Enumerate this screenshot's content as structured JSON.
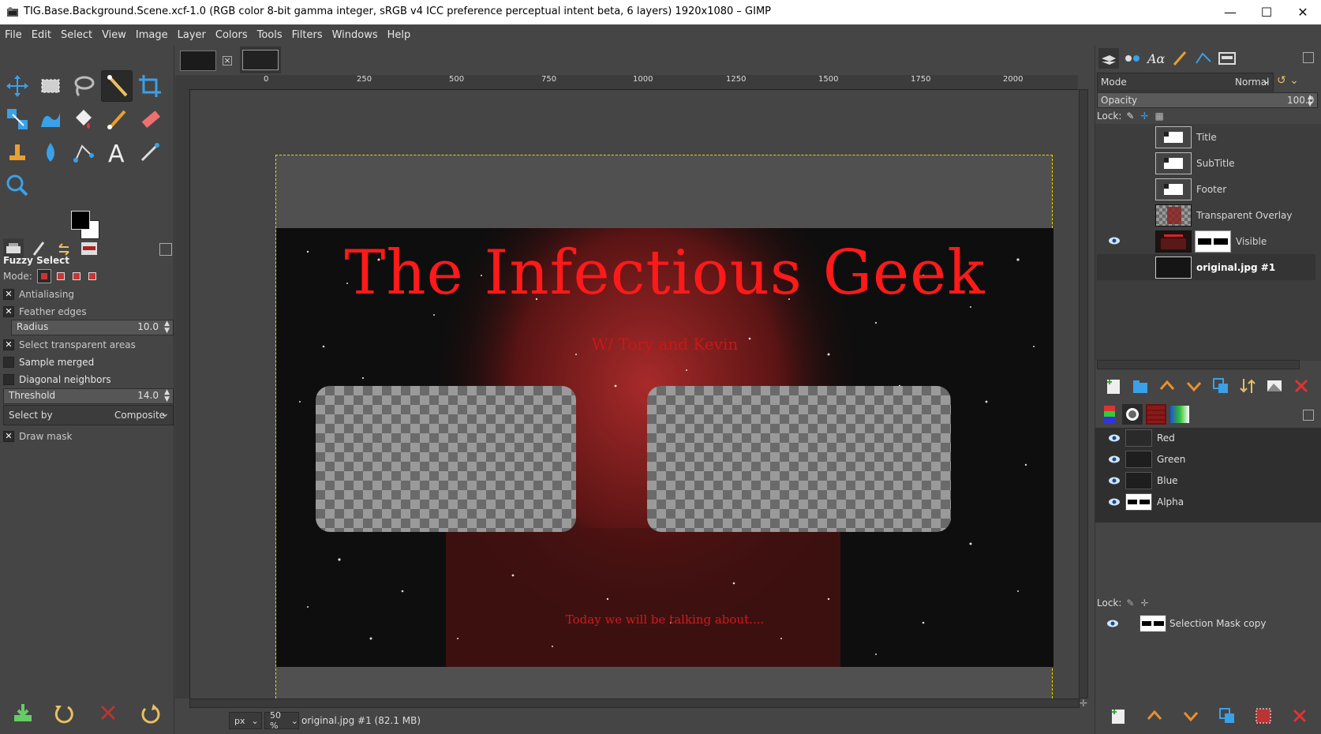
{
  "window": {
    "title": "TIG.Base.Background.Scene.xcf-1.0 (RGB color 8-bit gamma integer, sRGB v4 ICC preference perceptual intent beta, 6 layers) 1920x1080 – GIMP",
    "minimize": "—",
    "maximize": "☐",
    "close": "✕"
  },
  "menu": [
    "File",
    "Edit",
    "Select",
    "View",
    "Image",
    "Layer",
    "Colors",
    "Tools",
    "Filters",
    "Windows",
    "Help"
  ],
  "tool_options": {
    "title": "Fuzzy Select",
    "mode_label": "Mode:",
    "antialiasing": "Antialiasing",
    "feather_edges": "Feather edges",
    "radius_label": "Radius",
    "radius_value": "10.0",
    "select_transparent": "Select transparent areas",
    "sample_merged": "Sample merged",
    "diagonal_neighbors": "Diagonal neighbors",
    "threshold_label": "Threshold",
    "threshold_value": "14.0",
    "select_by_label": "Select by",
    "select_by_value": "Composite",
    "draw_mask": "Draw mask"
  },
  "ruler_ticks": [
    "0",
    "250",
    "500",
    "750",
    "1000",
    "1250",
    "1500",
    "1750",
    "2000"
  ],
  "image": {
    "headline": "The Infectious Geek",
    "subhead": "W/ Tory and Kevin",
    "footer": "Today we will be talking about...."
  },
  "status": {
    "unit": "px",
    "zoom": "50 %",
    "info": "original.jpg #1 (82.1 MB)"
  },
  "layers_panel": {
    "mode_label": "Mode",
    "mode_value": "Normal",
    "opacity_label": "Opacity",
    "opacity_value": "100.0",
    "lock_label": "Lock:",
    "layers": [
      {
        "name": "Title"
      },
      {
        "name": "SubTitle"
      },
      {
        "name": "Footer"
      },
      {
        "name": "Transparent Overlay"
      },
      {
        "name": "Visible"
      },
      {
        "name": "original.jpg #1"
      }
    ]
  },
  "channels_panel": {
    "channels": [
      "Red",
      "Green",
      "Blue",
      "Alpha"
    ],
    "lock_label": "Lock:",
    "custom": "Selection Mask copy"
  },
  "colors": {
    "accent_red": "#ff1a1a",
    "selection_marching": "#e8d800",
    "bg": "#454545"
  }
}
